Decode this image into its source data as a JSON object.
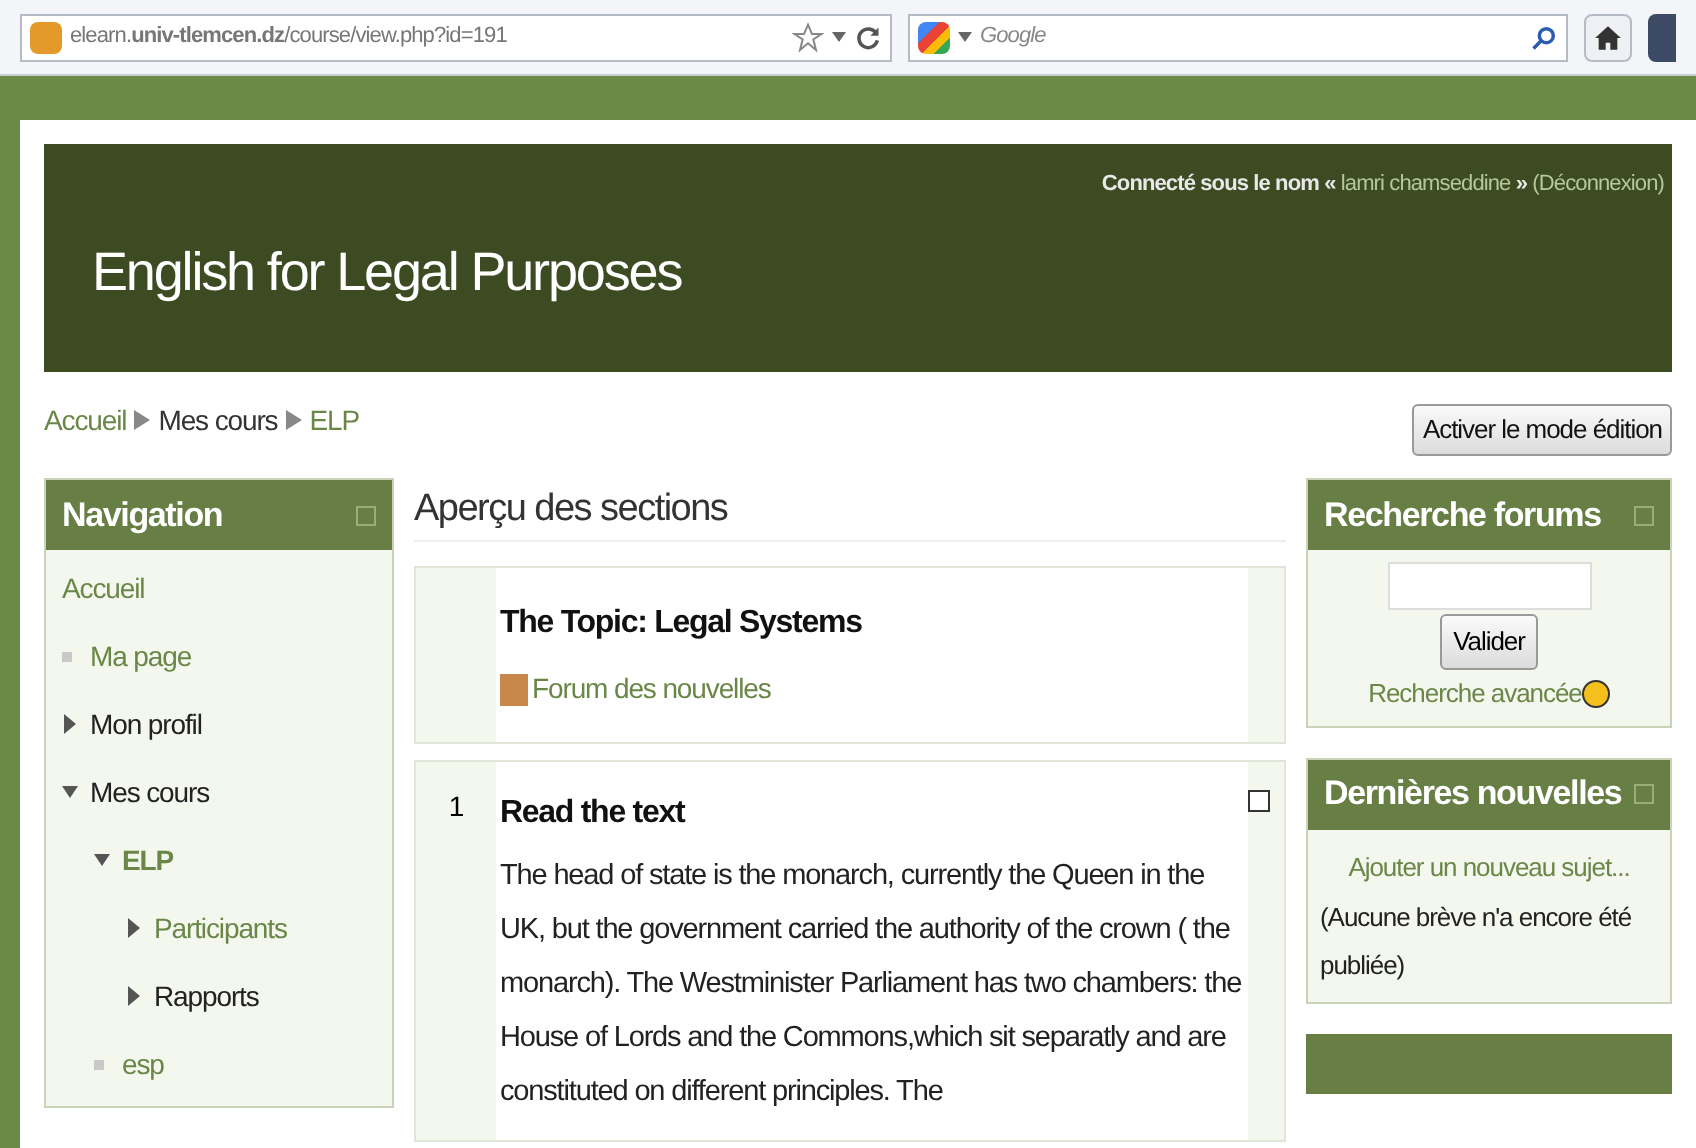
{
  "browser": {
    "url": "elearn.**univ-tlemcen.dz**/course/view.php?id=191",
    "search_placeholder": "Google"
  },
  "header": {
    "login_prefix": "Connecté sous le nom «",
    "user": "lamri chamseddine",
    "login_mid": "»",
    "logout": "(Déconnexion)",
    "title": "English for Legal Purposes"
  },
  "breadcrumb": [
    {
      "label": "Accueil",
      "link": true
    },
    {
      "label": "Mes cours",
      "link": false
    },
    {
      "label": "ELP",
      "link": true
    }
  ],
  "edit_button": "Activer le mode édition",
  "navigation": {
    "title": "Navigation",
    "items": [
      {
        "label": "Accueil",
        "kind": "plain",
        "link": true,
        "bold": false
      },
      {
        "label": "Ma page",
        "kind": "leaf",
        "link": true,
        "bold": false
      },
      {
        "label": "Mon profil",
        "kind": "branch",
        "expanded": false,
        "link": false,
        "bold": false
      },
      {
        "label": "Mes cours",
        "kind": "branch",
        "expanded": true,
        "link": false,
        "bold": false,
        "children": [
          {
            "label": "ELP",
            "kind": "branch",
            "expanded": true,
            "link": true,
            "bold": true,
            "children": [
              {
                "label": "Participants",
                "kind": "branch",
                "expanded": false,
                "link": true,
                "bold": false
              },
              {
                "label": "Rapports",
                "kind": "branch",
                "expanded": false,
                "link": false,
                "bold": false
              }
            ]
          },
          {
            "label": "esp",
            "kind": "leaf",
            "link": true,
            "bold": false
          }
        ]
      }
    ]
  },
  "main": {
    "title": "Aperçu des sections",
    "sections": [
      {
        "title": "The Topic: Legal Systems",
        "activity": "Forum des nouvelles"
      },
      {
        "number": "1",
        "title": "Read the text",
        "text": "The head of state is the monarch, currently the Queen in the UK, but the government carried the authority of the crown ( the monarch). The Westminister Parliament has two chambers: the House of Lords and the Commons,which sit separatly and are constituted on different principles. The",
        "checked": false
      }
    ]
  },
  "search_forums": {
    "title": "Recherche forums",
    "button": "Valider",
    "advanced": "Recherche avancée"
  },
  "news": {
    "title": "Dernières nouvelles",
    "add": "Ajouter un nouveau sujet...",
    "empty": "(Aucune brève n'a encore été publiée)"
  }
}
